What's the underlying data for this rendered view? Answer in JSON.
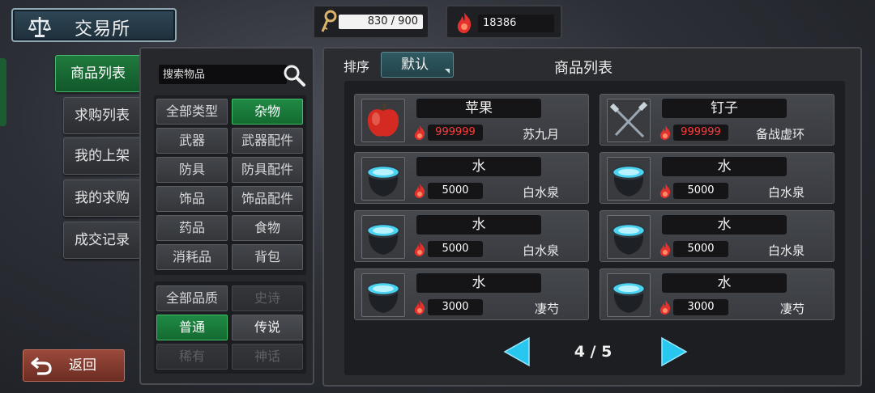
{
  "header": {
    "title": "交易所",
    "title_icon": "scales-icon",
    "capacity": {
      "icon": "key-icon",
      "text": "830 / 900",
      "current": 830,
      "max": 900
    },
    "currency": {
      "icon": "fire-currency-icon",
      "value": "18386"
    }
  },
  "side_tabs": [
    {
      "label": "商品列表",
      "active": true
    },
    {
      "label": "求购列表",
      "active": false
    },
    {
      "label": "我的上架",
      "active": false
    },
    {
      "label": "我的求购",
      "active": false
    },
    {
      "label": "成交记录",
      "active": false
    }
  ],
  "search": {
    "placeholder": "搜索物品",
    "icon": "search-icon"
  },
  "type_filters": [
    {
      "label": "全部类型",
      "state": "normal"
    },
    {
      "label": "杂物",
      "state": "active"
    },
    {
      "label": "武器",
      "state": "normal"
    },
    {
      "label": "武器配件",
      "state": "normal"
    },
    {
      "label": "防具",
      "state": "normal"
    },
    {
      "label": "防具配件",
      "state": "normal"
    },
    {
      "label": "饰品",
      "state": "normal"
    },
    {
      "label": "饰品配件",
      "state": "normal"
    },
    {
      "label": "药品",
      "state": "normal"
    },
    {
      "label": "食物",
      "state": "normal"
    },
    {
      "label": "消耗品",
      "state": "normal"
    },
    {
      "label": "背包",
      "state": "normal"
    }
  ],
  "quality_filters": [
    {
      "label": "全部品质",
      "state": "normal"
    },
    {
      "label": "史诗",
      "state": "dim"
    },
    {
      "label": "普通",
      "state": "active"
    },
    {
      "label": "传说",
      "state": "on-grey"
    },
    {
      "label": "稀有",
      "state": "dim"
    },
    {
      "label": "神话",
      "state": "dim"
    }
  ],
  "sort": {
    "label": "排序",
    "value": "默认"
  },
  "list_title": "商品列表",
  "items": [
    {
      "name": "苹果",
      "icon": "apple-icon",
      "price": "999999",
      "price_red": true,
      "seller": "苏九月"
    },
    {
      "name": "钉子",
      "icon": "nails-icon",
      "price": "999999",
      "price_red": true,
      "seller": "备战虚环"
    },
    {
      "name": "水",
      "icon": "water-pot-icon",
      "price": "5000",
      "price_red": false,
      "seller": "白水泉"
    },
    {
      "name": "水",
      "icon": "water-pot-icon",
      "price": "5000",
      "price_red": false,
      "seller": "白水泉"
    },
    {
      "name": "水",
      "icon": "water-pot-icon",
      "price": "5000",
      "price_red": false,
      "seller": "白水泉"
    },
    {
      "name": "水",
      "icon": "water-pot-icon",
      "price": "5000",
      "price_red": false,
      "seller": "白水泉"
    },
    {
      "name": "水",
      "icon": "water-pot-icon",
      "price": "3000",
      "price_red": false,
      "seller": "凄芍"
    },
    {
      "name": "水",
      "icon": "water-pot-icon",
      "price": "3000",
      "price_red": false,
      "seller": "凄芍"
    }
  ],
  "pagination": {
    "text": "4 / 5",
    "current": 4,
    "total": 5
  },
  "back": {
    "label": "返回",
    "icon": "back-arrow-icon"
  },
  "colors": {
    "active_green": "#1f8a44",
    "price_red": "#ff3b3b",
    "pager_cyan": "#27c7f0",
    "back_red": "#8a3f32"
  }
}
